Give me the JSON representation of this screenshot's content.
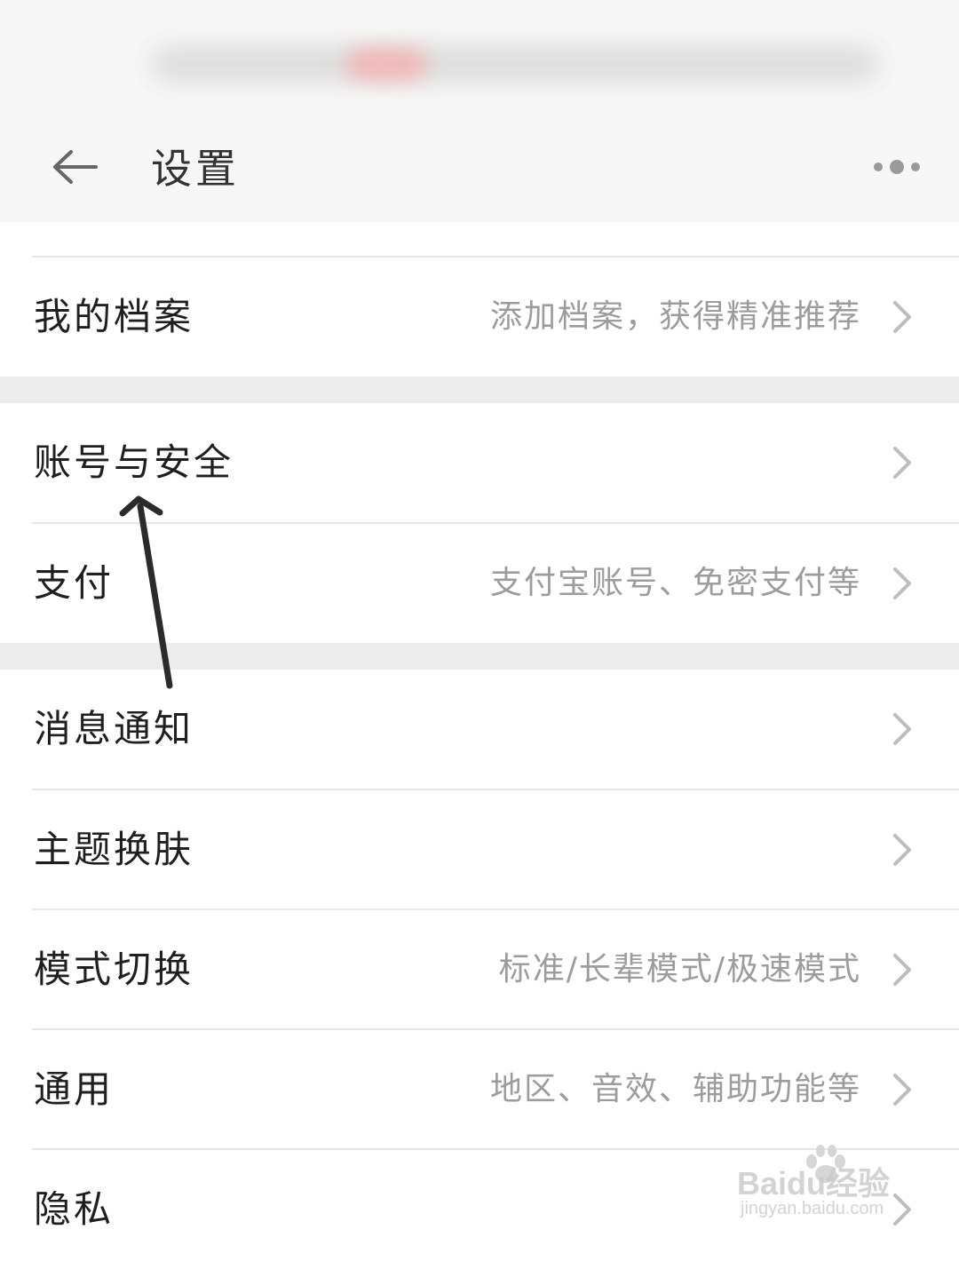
{
  "header": {
    "title": "设置",
    "back_icon": "back-arrow-icon",
    "more_icon": "more-dots-icon"
  },
  "rows": [
    {
      "label": "我的档案",
      "value": "添加档案，获得精准推荐"
    },
    {
      "label": "账号与安全",
      "value": ""
    },
    {
      "label": "支付",
      "value": "支付宝账号、免密支付等"
    },
    {
      "label": "消息通知",
      "value": ""
    },
    {
      "label": "主题换肤",
      "value": ""
    },
    {
      "label": "模式切换",
      "value": "标准/长辈模式/极速模式"
    },
    {
      "label": "通用",
      "value": "地区、音效、辅助功能等"
    },
    {
      "label": "隐私",
      "value": ""
    }
  ],
  "watermark": {
    "brand": "Baidu经验",
    "url": "jingyan.baidu.com"
  },
  "colors": {
    "header_bg": "#f7f7f7",
    "group_gap": "#ececec",
    "label_text": "#1f1f1f",
    "value_text": "#9c9c9c",
    "chevron": "#bdbdbd",
    "annotation_arrow": "#2b2b2b"
  }
}
